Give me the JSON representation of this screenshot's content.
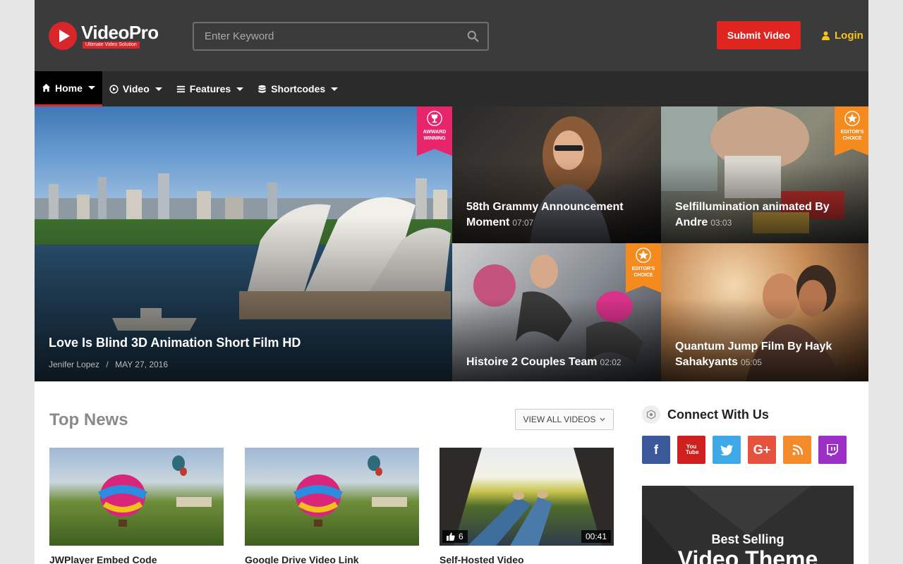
{
  "brand": {
    "name": "VideoPro",
    "tagline": "Ultimate Video Solution",
    "accent": "#d8262b"
  },
  "search": {
    "placeholder": "Enter Keyword"
  },
  "header": {
    "submit_label": "Submit Video",
    "login_label": "Login"
  },
  "nav": {
    "items": [
      {
        "label": "Home",
        "icon": "home-icon"
      },
      {
        "label": "Video",
        "icon": "play-circle-icon"
      },
      {
        "label": "Features",
        "icon": "list-icon"
      },
      {
        "label": "Shortcodes",
        "icon": "database-icon"
      }
    ]
  },
  "hero": {
    "featured": {
      "title": "Love Is Blind 3D Animation Short Film HD",
      "author": "Jenifer Lopez",
      "separator": "/",
      "date": "MAY 27, 2016",
      "badge": "AWWARD WINNING"
    },
    "tiles": [
      {
        "title": "58th Grammy Announcement Moment",
        "duration": "07:07",
        "badge": ""
      },
      {
        "title": "Selfillumination animated By Andre",
        "duration": "03:03",
        "badge": "EDITOR'S CHOICE"
      },
      {
        "title": "Histoire 2 Couples Team",
        "duration": "02:02",
        "badge": "EDITOR'S CHOICE"
      },
      {
        "title": "Quantum Jump Film By Hayk Sahakyants",
        "duration": "05:05",
        "badge": ""
      }
    ]
  },
  "top_news": {
    "title": "Top News",
    "view_all_label": "VIEW ALL VIDEOS",
    "cards": [
      {
        "title": "JWPlayer Embed Code"
      },
      {
        "title": "Google Drive Video Link"
      },
      {
        "title": "Self-Hosted Video",
        "likes": "6",
        "duration": "00:41"
      }
    ]
  },
  "sidebar": {
    "connect_title": "Connect With Us",
    "social": [
      {
        "name": "facebook-icon",
        "glyph": "f",
        "color": "#3b5998"
      },
      {
        "name": "youtube-icon",
        "glyph": "You Tube",
        "color": "#cd201f"
      },
      {
        "name": "twitter-icon",
        "glyph": "t",
        "color": "#3fa9e8"
      },
      {
        "name": "google-plus-icon",
        "glyph": "G+",
        "color": "#e5533e"
      },
      {
        "name": "rss-icon",
        "glyph": "rss",
        "color": "#f48b2a"
      },
      {
        "name": "twitch-icon",
        "glyph": "tw",
        "color": "#9c2fc5"
      }
    ],
    "ad": {
      "small": "Best Selling",
      "big": "Video Theme"
    }
  }
}
